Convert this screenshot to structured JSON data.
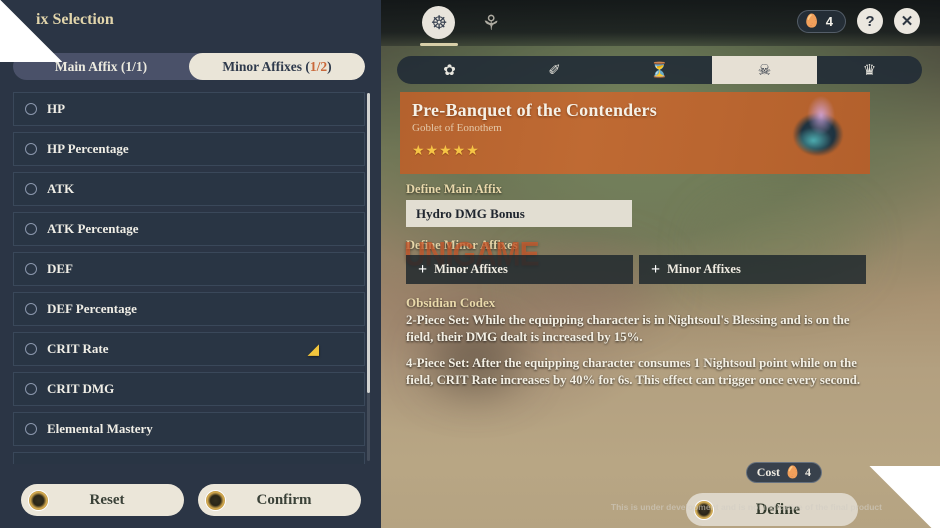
{
  "panel": {
    "title": "ix Selection",
    "tabs": [
      {
        "label": "Main Affix (1/1)",
        "selected": false
      },
      {
        "label": "Minor Affixes (",
        "count": "1/2",
        "close": ")",
        "selected": true
      }
    ],
    "affixes": [
      {
        "label": "HP",
        "cursor": false
      },
      {
        "label": "HP Percentage",
        "cursor": false
      },
      {
        "label": "ATK",
        "cursor": false
      },
      {
        "label": "ATK Percentage",
        "cursor": false
      },
      {
        "label": "DEF",
        "cursor": false
      },
      {
        "label": "DEF Percentage",
        "cursor": false
      },
      {
        "label": "CRIT Rate",
        "cursor": true
      },
      {
        "label": "CRIT DMG",
        "cursor": false
      },
      {
        "label": "Elemental Mastery",
        "cursor": false
      }
    ],
    "reset_label": "Reset",
    "confirm_label": "Confirm"
  },
  "topbar": {
    "nav": [
      {
        "icon": "artifact-sphere-icon",
        "glyph": "☸",
        "active": true
      },
      {
        "icon": "alchemy-flask-icon",
        "glyph": "⚘",
        "active": false
      }
    ],
    "currency": {
      "icon": "currency-icon",
      "glyph": "🥚",
      "value": "4"
    },
    "help_label": "?",
    "close_label": "✕"
  },
  "slot_tabs": [
    {
      "name": "flower",
      "glyph": "✿",
      "selected": false
    },
    {
      "name": "feather",
      "glyph": "✐",
      "selected": false
    },
    {
      "name": "sands",
      "glyph": "⏳",
      "selected": false
    },
    {
      "name": "goblet",
      "glyph": "ἷ7",
      "selected": true
    },
    {
      "name": "circlet",
      "glyph": "♛",
      "selected": false
    }
  ],
  "artifact": {
    "name": "Pre-Banquet of the Contenders",
    "slot": "Goblet of Eonothem",
    "rarity": 5,
    "stars": "★★★★★"
  },
  "define": {
    "main_affix_label": "Define Main Affix",
    "main_affix_value": "Hydro DMG Bonus",
    "minor_affix_label": "Define Minor Affixes",
    "minor_slots": [
      {
        "plus": "+",
        "label": "Minor Affixes"
      },
      {
        "plus": "+",
        "label": "Minor Affixes"
      }
    ]
  },
  "set_bonus": {
    "name": "Obsidian Codex",
    "lines": [
      "2-Piece Set: While the equipping character is in Nightsoul's Blessing and is on the field, their DMG dealt is increased by 15%.",
      "4-Piece Set: After the equipping character consumes 1 Nightsoul point while on the field, CRIT Rate increases by 40% for 6s. This effect can trigger once every second."
    ]
  },
  "footer": {
    "cost_label": "Cost",
    "cost_glyph": "🥚",
    "cost_value": "4",
    "define_label": "Define",
    "disclaimer": "This is under development and is not indicative of the final product"
  },
  "watermark": {
    "text": "UNIGAME"
  },
  "colors": {
    "panel_bg": "#2b3545",
    "accent_gold": "#e2d5ab",
    "card_orange": "#b4622e",
    "tab_active": "#eae5d8",
    "star": "#f6c445"
  }
}
